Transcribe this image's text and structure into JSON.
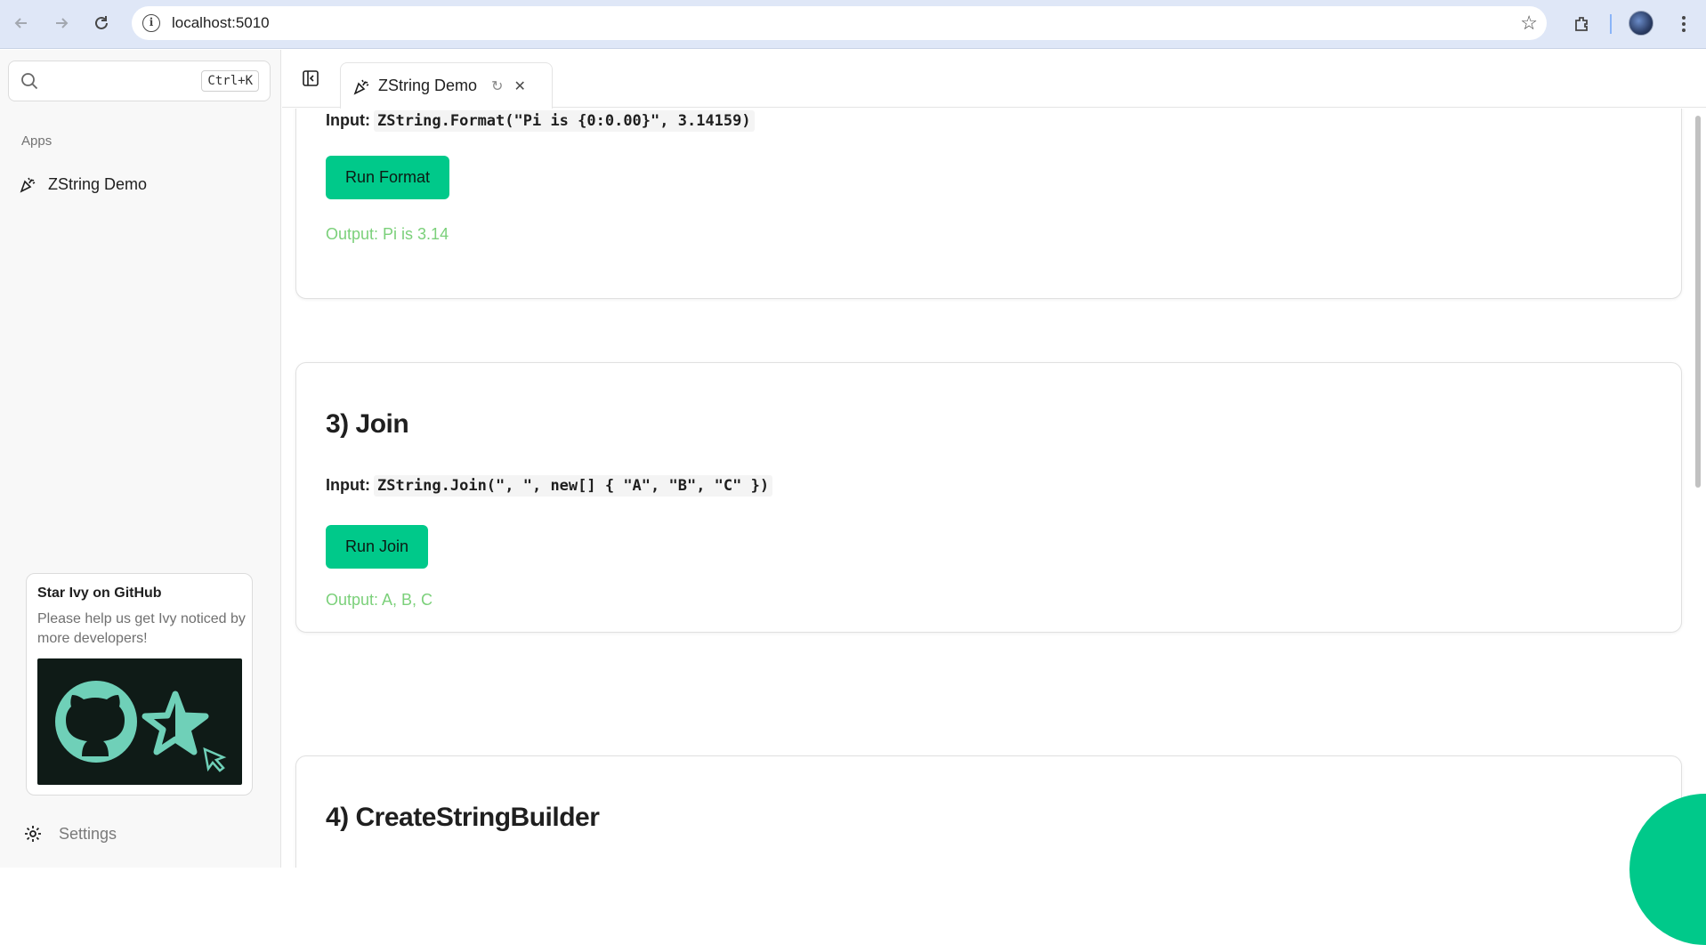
{
  "browser": {
    "url": "localhost:5010",
    "back_icon": "arrow-left",
    "forward_icon": "arrow-right",
    "reload_icon": "reload",
    "info_icon": "info",
    "bookmark_icon": "star",
    "extensions_icon": "puzzle",
    "menu_icon": "more-vert"
  },
  "sidebar": {
    "search": {
      "placeholder": "",
      "shortcut": "Ctrl+K"
    },
    "section_label": "Apps",
    "items": [
      {
        "label": "ZString Demo",
        "icon": "party-popper"
      }
    ],
    "promo": {
      "title": "Star Ivy on GitHub",
      "text": "Please help us get Ivy noticed by more developers!"
    },
    "settings_label": "Settings"
  },
  "tabs": [
    {
      "label": "ZString Demo",
      "icon": "party-popper"
    }
  ],
  "sections": [
    {
      "input_label": "Input:",
      "input_code": "ZString.Format(\"Pi is {0:0.00}\", 3.14159)",
      "button": "Run Format",
      "output": "Output: Pi is 3.14"
    },
    {
      "title": "3) Join",
      "input_label": "Input:",
      "input_code": "ZString.Join(\", \", new[] { \"A\", \"B\", \"C\" })",
      "button": "Run Join",
      "output": "Output: A, B, C"
    },
    {
      "title": "4) CreateStringBuilder"
    }
  ],
  "colors": {
    "accent": "#00c98a",
    "output_text": "#7bd07a",
    "browser_bar": "#dfe7f7"
  }
}
